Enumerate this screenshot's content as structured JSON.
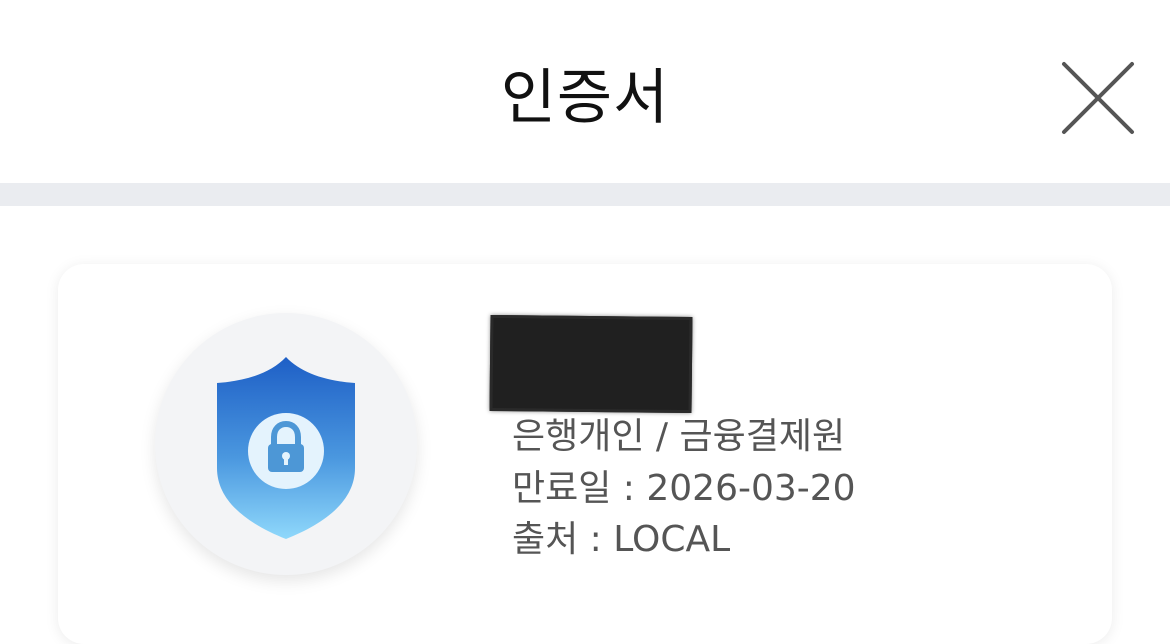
{
  "header": {
    "title": "인증서",
    "close_icon": "close-icon"
  },
  "certificate": {
    "emblem_icon": "shield-lock-icon",
    "name": "",
    "issuer": "은행개인 / 금융결제원",
    "expiry": "만료일 : 2026-03-20",
    "source": "출처 : LOCAL"
  },
  "colors": {
    "divider": "#eaecf0",
    "shield_top": "#1e5fc6",
    "shield_bottom": "#8fd8fb",
    "text_secondary": "#555555"
  }
}
